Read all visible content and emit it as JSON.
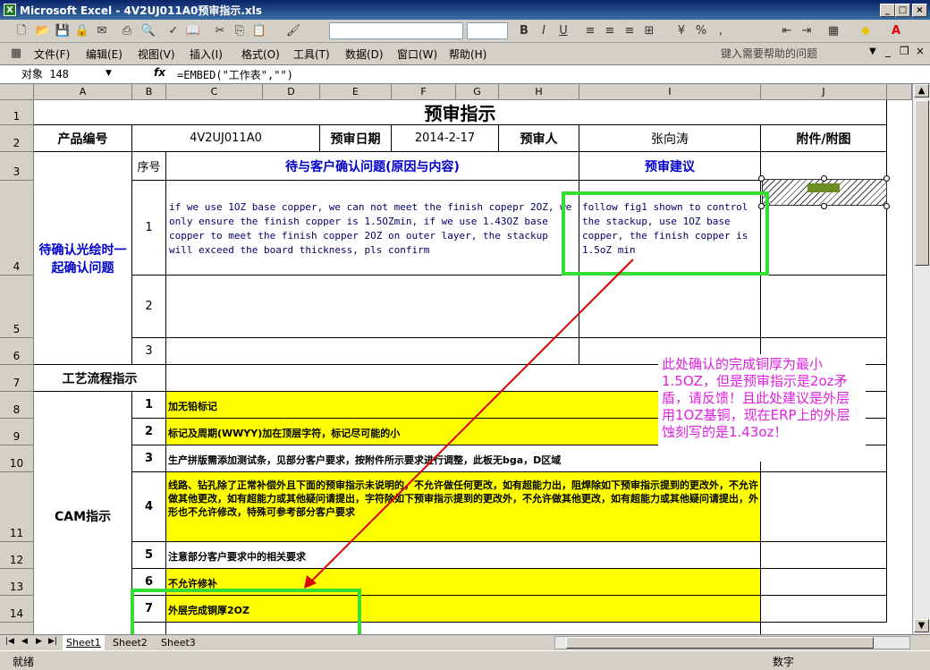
{
  "window": {
    "title": "Microsoft Excel - 4V2UJ011A0预审指示.xls"
  },
  "menu": {
    "items": [
      "文件(F)",
      "编辑(E)",
      "视图(V)",
      "插入(I)",
      "格式(O)",
      "工具(T)",
      "数据(D)",
      "窗口(W)",
      "帮助(H)"
    ],
    "help_placeholder": "键入需要帮助的问题"
  },
  "formula_bar": {
    "name_box": "对象 148",
    "fx": "fx",
    "formula": "=EMBED(\"工作表\",\"\")"
  },
  "columns": [
    "A",
    "B",
    "C",
    "D",
    "E",
    "F",
    "G",
    "H",
    "I",
    "J"
  ],
  "rows": [
    "1",
    "2",
    "3",
    "4",
    "5",
    "6",
    "7",
    "8",
    "9",
    "10",
    "11",
    "12",
    "13",
    "14"
  ],
  "sheet": {
    "title": "预审指示",
    "row2": {
      "label_product": "产品编号",
      "product_no": "4V2UJ011A0",
      "label_date": "预审日期",
      "date": "2014-2-17",
      "label_reviewer": "预审人",
      "reviewer": "张向涛",
      "label_attach": "附件/附图"
    },
    "row3": {
      "seq": "序号",
      "question_header": "待与客户确认问题(原因与内容)",
      "suggestion_header": "预审建议"
    },
    "confirm_label": "待确认光绘时一起确认问题",
    "q1_no": "1",
    "q1_text": "if we use 1OZ base copper, we can not meet the finish copepr 2OZ, we only ensure the finish copper is 1.5OZmin, if we use 1.43OZ base copper to meet the finish copper 2OZ on outer layer, the stackup will exceed the board thickness, pls confirm",
    "q1_suggestion": "follow fig1 shown to control the stackup, use 1OZ base copper, the finish copper is 1.5oZ min",
    "q2_no": "2",
    "q3_no": "3",
    "process_label": "工艺流程指示",
    "cam_label": "CAM指示",
    "cam_items": [
      {
        "no": "1",
        "text": "加无铅标记"
      },
      {
        "no": "2",
        "text": "标记及周期(WWYY)加在顶层字符，标记尽可能的小"
      },
      {
        "no": "3",
        "text": "生产拼版需添加测试条，见部分客户要求，按附件所示要求进行调整，此板无bga，D区域"
      },
      {
        "no": "4",
        "text": "线路、钻孔除了正常补偿外且下面的预审指示未说明的，不允许做任何更改，如有超能力出，阻焊除如下预审指示提到的更改外，不允许做其他更改，如有超能力或其他疑问请提出，字符除如下预审指示提到的更改外，不允许做其他更改，如有超能力或其他疑问请提出，外形也不允许修改，特殊可参考部分客户要求"
      },
      {
        "no": "5",
        "text": "注意部分客户要求中的相关要求"
      },
      {
        "no": "6",
        "text": "不允许修补"
      },
      {
        "no": "7",
        "text": "外层完成铜厚2OZ"
      }
    ],
    "annotation": "此处确认的完成铜厚为最小1.5OZ，但是预审指示是2oz矛盾，请反馈！且此处建议是外层用1OZ基铜，现在ERP上的外层蚀刻写的是1.43oz！"
  },
  "sheet_tabs": [
    "Sheet1",
    "Sheet2",
    "Sheet3"
  ],
  "status": {
    "left": "就绪",
    "mode": "数字"
  },
  "colors": {
    "highlight_green": "#33dd33",
    "annotation_magenta": "#e020e0",
    "arrow_red": "#dd0000",
    "fill_yellow": "#ffff00"
  }
}
